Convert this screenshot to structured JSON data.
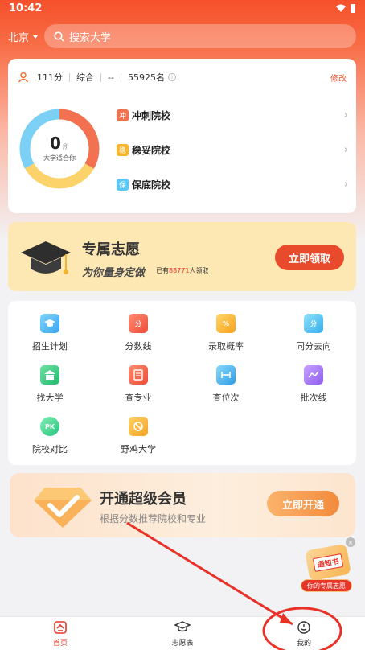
{
  "status_bar": {
    "time": "10:42"
  },
  "header": {
    "city": "北京",
    "search_placeholder": "搜索大学"
  },
  "score_card": {
    "score": "111分",
    "subject": "综合",
    "dash": "--",
    "rank": "55925名",
    "edit": "修改",
    "donut_count": "0",
    "donut_unit": "所",
    "donut_label": "大学适合你",
    "tiers": [
      {
        "tag": "冲",
        "label": "冲刺院校",
        "color": "#f27151"
      },
      {
        "tag": "稳",
        "label": "稳妥院校",
        "color": "#f7b52c"
      },
      {
        "tag": "保",
        "label": "保底院校",
        "color": "#5ac8f6"
      }
    ]
  },
  "vip_banner": {
    "title": "专属志愿",
    "subtitle": "为你量身定做",
    "count_prefix": "已有",
    "count_value": "88771",
    "count_suffix": "人领取",
    "button": "立即领取"
  },
  "features": [
    {
      "label": "招生计划",
      "icon": "graduation-plan-icon"
    },
    {
      "label": "分数线",
      "icon": "score-line-icon"
    },
    {
      "label": "录取概率",
      "icon": "probability-icon"
    },
    {
      "label": "同分去向",
      "icon": "same-score-icon"
    },
    {
      "label": "找大学",
      "icon": "find-university-icon"
    },
    {
      "label": "查专业",
      "icon": "major-icon"
    },
    {
      "label": "查位次",
      "icon": "rank-icon"
    },
    {
      "label": "批次线",
      "icon": "batch-line-icon"
    },
    {
      "label": "院校对比",
      "icon": "compare-icon"
    },
    {
      "label": "野鸡大学",
      "icon": "fake-university-icon"
    }
  ],
  "member_banner": {
    "title": "开通超级会员",
    "subtitle": "根据分数推荐院校和专业",
    "button": "立即开通"
  },
  "float_promo": {
    "book_label": "通知书",
    "pill_label": "你的专属志愿"
  },
  "tabbar": {
    "tabs": [
      {
        "label": "首页"
      },
      {
        "label": "志愿表"
      },
      {
        "label": "我的"
      }
    ]
  },
  "colors": {
    "accent": "#e8352a",
    "brand": "#f5502b"
  }
}
